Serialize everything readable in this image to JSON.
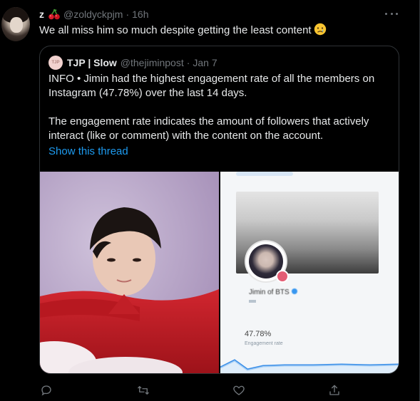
{
  "tweet": {
    "display_name": "z",
    "name_emoji": "cherry-icon",
    "handle": "@zoldyckpjm",
    "separator": "·",
    "time": "16h",
    "text": "We all miss him so much despite getting the least content",
    "text_emoji": "crying-face-icon",
    "more_icon": "more-icon"
  },
  "quoted": {
    "display_name": "TJP | Slow",
    "avatar_text": "TJP",
    "handle": "@thejiminpost",
    "separator": "·",
    "time": "Jan 7",
    "lines_p1": [
      "INFO • Jimin had the highest engagement rate of all the members on",
      "Instagram (47.78%) over the last 14 days."
    ],
    "lines_p2": [
      "The engagement rate indicates the amount of followers that actively",
      "interact (like or comment) with the content on the account."
    ],
    "show_thread": "Show this thread",
    "media": {
      "right_profile_name": "Jimin of BTS",
      "right_rate": "47.78%",
      "right_rate_label": "Engagement rate"
    }
  },
  "actions": [
    {
      "name": "reply",
      "icon": "reply-icon"
    },
    {
      "name": "retweet",
      "icon": "retweet-icon"
    },
    {
      "name": "like",
      "icon": "heart-icon"
    },
    {
      "name": "share",
      "icon": "share-icon"
    }
  ],
  "colors": {
    "background": "#000000",
    "text": "#e7e9ea",
    "muted": "#71767b",
    "link": "#1d9bf0",
    "border": "#2f3336"
  }
}
